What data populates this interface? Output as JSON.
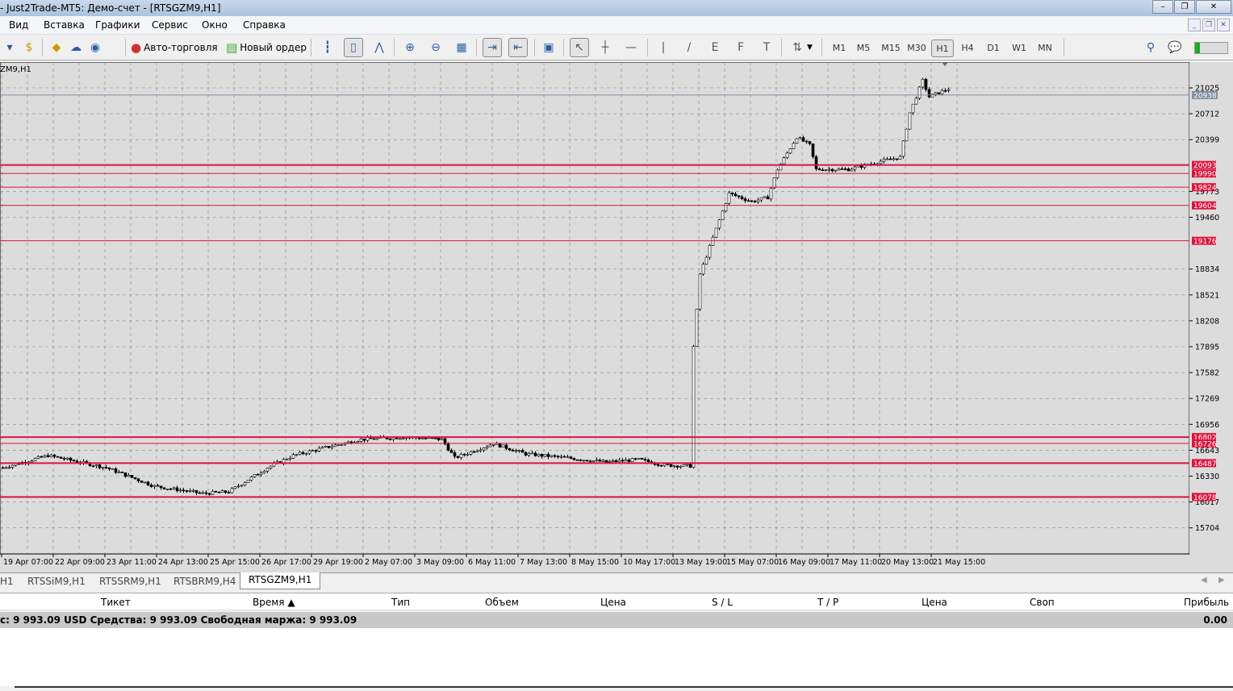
{
  "window": {
    "title": "- Just2Trade-MT5: Демо-счет - [RTSGZM9,H1]",
    "minimize": "–",
    "restore": "❐",
    "close": "✕"
  },
  "menu": [
    "Вид",
    "Вставка",
    "Графики",
    "Сервис",
    "Окно",
    "Справка"
  ],
  "toolbar": {
    "auto_trading": "Авто-торговля",
    "new_order": "Новый ордер",
    "timeframes": [
      "M1",
      "M5",
      "M15",
      "M30",
      "H1",
      "H4",
      "D1",
      "W1",
      "MN"
    ],
    "active_timeframe": "H1"
  },
  "chart": {
    "symbol_label": "ZM9,H1"
  },
  "chart_data": {
    "type": "candlestick",
    "symbol": "RTSGZM9",
    "timeframe": "H1",
    "price_ticks": [
      21025,
      20712,
      20399,
      19773,
      19460,
      18834,
      18521,
      18208,
      17895,
      17582,
      17269,
      16956,
      16643,
      16330,
      16017,
      15704
    ],
    "time_labels": [
      "19 Apr 07:00",
      "22 Apr 09:00",
      "23 Apr 11:00",
      "24 Apr 13:00",
      "25 Apr 15:00",
      "26 Apr 17:00",
      "29 Apr 19:00",
      "2 May 07:00",
      "3 May 09:00",
      "6 May 11:00",
      "7 May 13:00",
      "8 May 15:00",
      "10 May 17:00",
      "13 May 19:00",
      "15 May 07:00",
      "16 May 09:00",
      "17 May 11:00",
      "20 May 13:00",
      "21 May 15:00"
    ],
    "bars_per_label": 16,
    "levels": [
      {
        "price": 20093,
        "thick": true
      },
      {
        "price": 19990
      },
      {
        "price": 19824
      },
      {
        "price": 19604
      },
      {
        "price": 19176
      },
      {
        "price": 16802,
        "thick": true
      },
      {
        "price": 16726
      },
      {
        "price": 16487,
        "thick": true
      },
      {
        "price": 16078,
        "thick": true
      }
    ],
    "current_price": 20938,
    "level_color": "#dc143c",
    "close_path": [
      [
        0,
        16433
      ],
      [
        14,
        16579
      ],
      [
        32,
        16433
      ],
      [
        47,
        16208
      ],
      [
        62,
        16120
      ],
      [
        70,
        16140
      ],
      [
        82,
        16433
      ],
      [
        90,
        16579
      ],
      [
        100,
        16676
      ],
      [
        111,
        16774
      ],
      [
        125,
        16803
      ],
      [
        136,
        16774
      ],
      [
        140,
        16550
      ],
      [
        152,
        16725
      ],
      [
        162,
        16598
      ],
      [
        175,
        16550
      ],
      [
        187,
        16500
      ],
      [
        197,
        16530
      ],
      [
        205,
        16462
      ],
      [
        213,
        16452
      ],
      [
        214,
        17895
      ],
      [
        216,
        18773
      ],
      [
        220,
        19212
      ],
      [
        225,
        19748
      ],
      [
        232,
        19650
      ],
      [
        237,
        19700
      ],
      [
        240,
        20040
      ],
      [
        246,
        20430
      ],
      [
        250,
        20333
      ],
      [
        252,
        20040
      ],
      [
        262,
        20040
      ],
      [
        272,
        20138
      ],
      [
        278,
        20186
      ],
      [
        281,
        20723
      ],
      [
        285,
        21113
      ],
      [
        287,
        20918
      ],
      [
        293,
        21015
      ]
    ]
  },
  "tabs": [
    "H1",
    "RTSSiM9,H1",
    "RTSSRM9,H1",
    "RTSBRM9,H4",
    "RTSGZM9,H1"
  ],
  "active_tab": "RTSGZM9,H1",
  "table": {
    "columns": [
      "Тикет",
      "Время ▲",
      "Тип",
      "Объем",
      "Цена",
      "S / L",
      "T / P",
      "Цена",
      "Своп",
      "Прибыль"
    ]
  },
  "summary": {
    "text": "с: 9 993.09 USD  Средства: 9 993.09  Свободная маржа: 9 993.09",
    "profit": "0.00"
  }
}
